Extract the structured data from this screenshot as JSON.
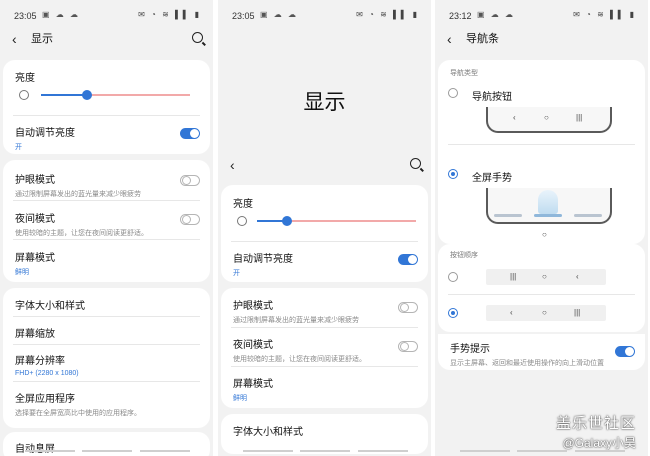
{
  "panel1": {
    "status_time": "23:05",
    "title": "显示",
    "brightness_label": "亮度",
    "brightness_level": 0.31,
    "auto_brightness": {
      "label": "自动调节亮度",
      "value": "开",
      "on": true
    },
    "eye_comfort": {
      "label": "护眼模式",
      "desc": "通过限制屏幕发出的蓝光量来减少眼疲劳",
      "on": false
    },
    "night_mode": {
      "label": "夜间模式",
      "desc": "使用较暗的主题，让您在夜间阅读更舒适。",
      "on": false
    },
    "screen_mode": {
      "label": "屏幕模式",
      "value": "鲜明"
    },
    "font_size": "字体大小和样式",
    "screen_zoom": "屏幕缩放",
    "resolution": {
      "label": "屏幕分辨率",
      "value": "FHD+ (2280 x 1080)"
    },
    "fullscreen_apps": {
      "label": "全屏应用程序",
      "desc": "选择要在全屏宽高比中使用的应用程序。"
    },
    "auto_rotate": "自动息屏"
  },
  "panel2": {
    "status_time": "23:05",
    "big_title": "显示",
    "brightness_label": "亮度",
    "brightness_level": 0.19,
    "auto_brightness": {
      "label": "自动调节亮度",
      "value": "开",
      "on": true
    },
    "eye_comfort": {
      "label": "护眼模式",
      "desc": "通过限制屏幕发出的蓝光量来减少眼疲劳",
      "on": false
    },
    "night_mode": {
      "label": "夜间模式",
      "desc": "使用较暗的主题，让您在夜间阅读更舒适。",
      "on": false
    },
    "screen_mode": {
      "label": "屏幕模式",
      "value": "鲜明"
    },
    "font_size": "字体大小和样式"
  },
  "panel3": {
    "status_time": "23:12",
    "title": "导航条",
    "nav_type_header": "导航类型",
    "nav_buttons_label": "导航按钮",
    "gestures_label": "全屏手势",
    "key_symbols": {
      "recent": "|||",
      "home": "○",
      "back": "‹"
    },
    "button_order_header": "按钮顺序",
    "gesture_hints": {
      "label": "手势提示",
      "desc": "显示主屏幕、返回和最近使用操作的向上滑动位置",
      "on": true
    }
  },
  "watermark": {
    "site": "盖乐世社区",
    "user": "@Galaxy小昊"
  },
  "colors": {
    "accent": "#3176d6",
    "slider_track": "#f2a9a9",
    "background": "#f2f2f2"
  }
}
